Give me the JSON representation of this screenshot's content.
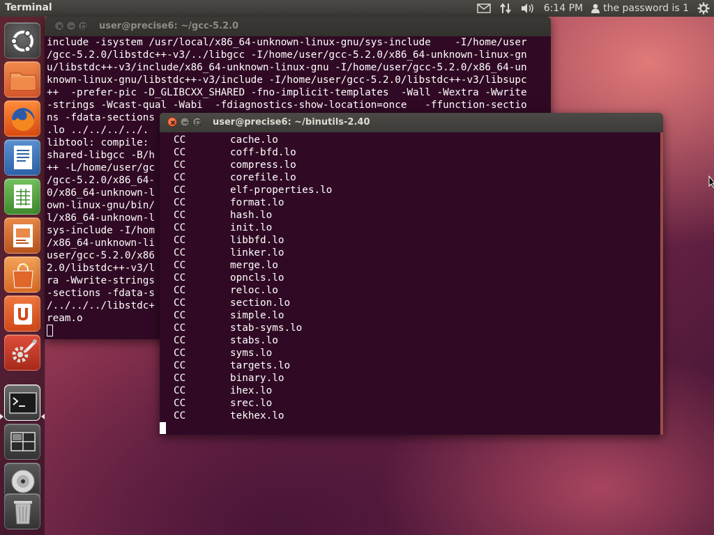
{
  "panel": {
    "app_title": "Terminal",
    "time": "6:14 PM",
    "user": "the password is 1",
    "icons": [
      "mail-icon",
      "network-icon",
      "volume-icon",
      "user-icon",
      "session-gear-icon"
    ]
  },
  "launcher": {
    "items": [
      {
        "name": "dash-home",
        "icon": "ubuntu-logo-icon"
      },
      {
        "name": "files",
        "icon": "folder-icon"
      },
      {
        "name": "firefox",
        "icon": "firefox-icon"
      },
      {
        "name": "libreoffice-writer",
        "icon": "writer-icon"
      },
      {
        "name": "libreoffice-calc",
        "icon": "calc-icon"
      },
      {
        "name": "libreoffice-impress",
        "icon": "impress-icon"
      },
      {
        "name": "software-center",
        "icon": "shopping-bag-icon"
      },
      {
        "name": "ubuntu-one",
        "icon": "ubuntu-one-icon"
      },
      {
        "name": "system-settings",
        "icon": "settings-icon"
      },
      {
        "name": "terminal",
        "icon": "terminal-icon",
        "active": true
      },
      {
        "name": "workspace-switcher",
        "icon": "workspaces-icon"
      },
      {
        "name": "dvd",
        "icon": "disc-icon"
      },
      {
        "name": "trash",
        "icon": "trash-icon"
      }
    ]
  },
  "window_back": {
    "title": "user@precise6: ~/gcc-5.2.0",
    "lines": [
      "include -isystem /usr/local/x86_64-unknown-linux-gnu/sys-include    -I/home/user",
      "/gcc-5.2.0/libstdc++-v3/../libgcc -I/home/user/gcc-5.2.0/x86_64-unknown-linux-gn",
      "u/libstdc++-v3/include/x86_64-unknown-linux-gnu -I/home/user/gcc-5.2.0/x86_64-un",
      "known-linux-gnu/libstdc++-v3/include -I/home/user/gcc-5.2.0/libstdc++-v3/libsupc",
      "++  -prefer-pic -D_GLIBCXX_SHARED -fno-implicit-templates  -Wall -Wextra -Wwrite",
      "-strings -Wcast-qual -Wabi  -fdiagnostics-show-location=once   -ffunction-sectio",
      "ns -fdata-sections",
      ".lo ../../../../.",
      "libtool: compile:",
      "shared-libgcc -B/h",
      "++ -L/home/user/gc",
      "/gcc-5.2.0/x86_64-",
      "0/x86_64-unknown-l",
      "own-linux-gnu/bin/",
      "l/x86_64-unknown-l",
      "sys-include -I/hom",
      "/x86_64-unknown-li",
      "user/gcc-5.2.0/x86",
      "2.0/libstdc++-v3/l",
      "ra -Wwrite-strings",
      "-sections -fdata-s",
      "/../../../libstdc+",
      "ream.o"
    ]
  },
  "window_front": {
    "title": "user@precise6: ~/binutils-2.40",
    "rows": [
      {
        "tag": "CC",
        "file": "cache.lo"
      },
      {
        "tag": "CC",
        "file": "coff-bfd.lo"
      },
      {
        "tag": "CC",
        "file": "compress.lo"
      },
      {
        "tag": "CC",
        "file": "corefile.lo"
      },
      {
        "tag": "CC",
        "file": "elf-properties.lo"
      },
      {
        "tag": "CC",
        "file": "format.lo"
      },
      {
        "tag": "CC",
        "file": "hash.lo"
      },
      {
        "tag": "CC",
        "file": "init.lo"
      },
      {
        "tag": "CC",
        "file": "libbfd.lo"
      },
      {
        "tag": "CC",
        "file": "linker.lo"
      },
      {
        "tag": "CC",
        "file": "merge.lo"
      },
      {
        "tag": "CC",
        "file": "opncls.lo"
      },
      {
        "tag": "CC",
        "file": "reloc.lo"
      },
      {
        "tag": "CC",
        "file": "section.lo"
      },
      {
        "tag": "CC",
        "file": "simple.lo"
      },
      {
        "tag": "CC",
        "file": "stab-syms.lo"
      },
      {
        "tag": "CC",
        "file": "stabs.lo"
      },
      {
        "tag": "CC",
        "file": "syms.lo"
      },
      {
        "tag": "CC",
        "file": "targets.lo"
      },
      {
        "tag": "CC",
        "file": "binary.lo"
      },
      {
        "tag": "CC",
        "file": "ihex.lo"
      },
      {
        "tag": "CC",
        "file": "srec.lo"
      },
      {
        "tag": "CC",
        "file": "tekhex.lo"
      }
    ]
  },
  "colors": {
    "terminal_bg": "#300a24",
    "panel_bg": "#3c3b37",
    "close_button": "#e0502a"
  }
}
